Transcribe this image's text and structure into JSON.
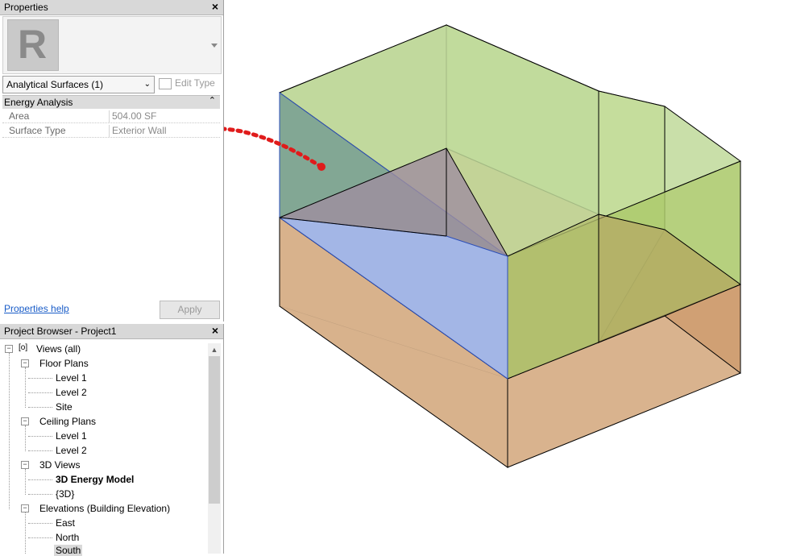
{
  "properties": {
    "title": "Properties",
    "close": "×",
    "logo_letter": "R",
    "type_selector": "Analytical Surfaces (1)",
    "edit_type": "Edit Type",
    "group": "Energy Analysis",
    "collapse": "⌃",
    "rows": [
      {
        "key": "Area",
        "value": "504.00 SF"
      },
      {
        "key": "Surface Type",
        "value": "Exterior Wall"
      }
    ],
    "help": "Properties help",
    "apply": "Apply"
  },
  "browser": {
    "title": "Project Browser - Project1",
    "close": "×",
    "root": "Views (all)",
    "floor_plans": "Floor Plans",
    "fp_items": [
      "Level 1",
      "Level 2",
      "Site"
    ],
    "ceiling_plans": "Ceiling Plans",
    "cp_items": [
      "Level 1",
      "Level 2"
    ],
    "views_3d": "3D Views",
    "v3d_items": [
      "3D Energy Model",
      "{3D}"
    ],
    "elevations": "Elevations (Building Elevation)",
    "el_items": [
      "East",
      "North",
      "South"
    ]
  },
  "colors": {
    "green_face": "#b9d98a",
    "orange_face": "#cfa072",
    "blue_face": "#9db5e8",
    "arrow": "#e01b1b"
  }
}
